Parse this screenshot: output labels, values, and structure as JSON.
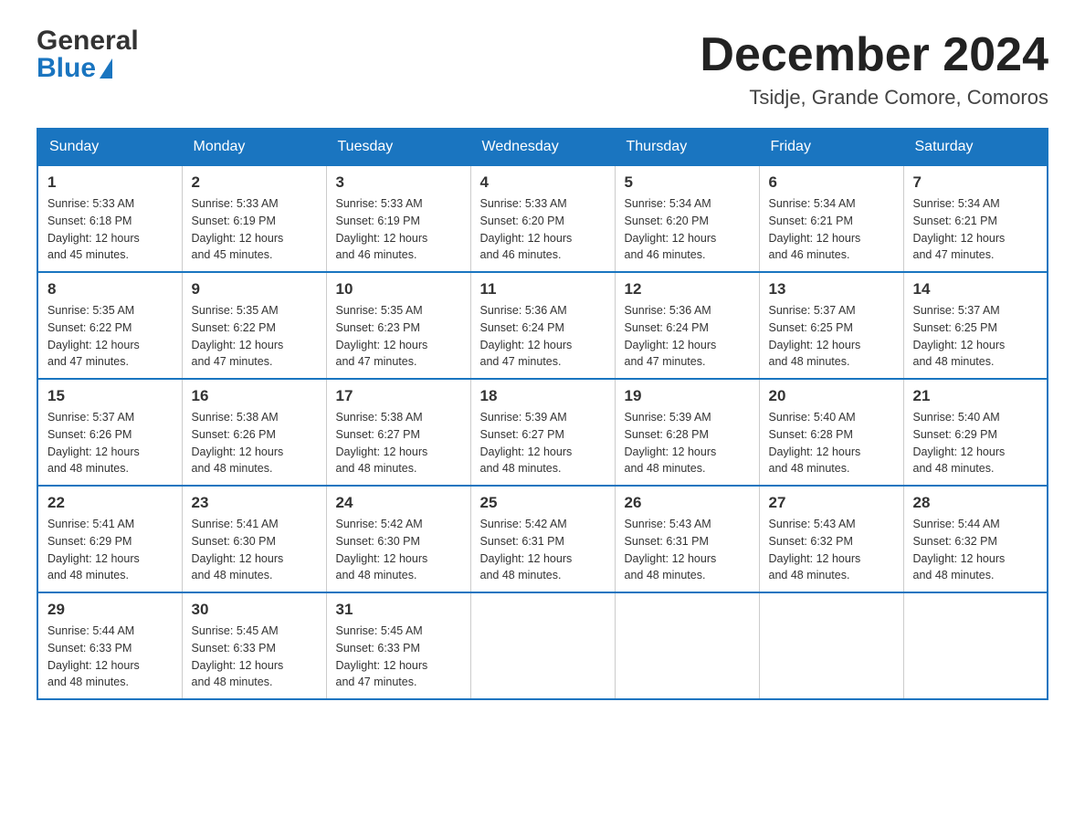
{
  "header": {
    "logo_line1": "General",
    "logo_line2": "Blue",
    "title": "December 2024",
    "subtitle": "Tsidje, Grande Comore, Comoros"
  },
  "calendar": {
    "days_of_week": [
      "Sunday",
      "Monday",
      "Tuesday",
      "Wednesday",
      "Thursday",
      "Friday",
      "Saturday"
    ],
    "weeks": [
      [
        {
          "day": "1",
          "sunrise": "5:33 AM",
          "sunset": "6:18 PM",
          "daylight": "12 hours and 45 minutes."
        },
        {
          "day": "2",
          "sunrise": "5:33 AM",
          "sunset": "6:19 PM",
          "daylight": "12 hours and 45 minutes."
        },
        {
          "day": "3",
          "sunrise": "5:33 AM",
          "sunset": "6:19 PM",
          "daylight": "12 hours and 46 minutes."
        },
        {
          "day": "4",
          "sunrise": "5:33 AM",
          "sunset": "6:20 PM",
          "daylight": "12 hours and 46 minutes."
        },
        {
          "day": "5",
          "sunrise": "5:34 AM",
          "sunset": "6:20 PM",
          "daylight": "12 hours and 46 minutes."
        },
        {
          "day": "6",
          "sunrise": "5:34 AM",
          "sunset": "6:21 PM",
          "daylight": "12 hours and 46 minutes."
        },
        {
          "day": "7",
          "sunrise": "5:34 AM",
          "sunset": "6:21 PM",
          "daylight": "12 hours and 47 minutes."
        }
      ],
      [
        {
          "day": "8",
          "sunrise": "5:35 AM",
          "sunset": "6:22 PM",
          "daylight": "12 hours and 47 minutes."
        },
        {
          "day": "9",
          "sunrise": "5:35 AM",
          "sunset": "6:22 PM",
          "daylight": "12 hours and 47 minutes."
        },
        {
          "day": "10",
          "sunrise": "5:35 AM",
          "sunset": "6:23 PM",
          "daylight": "12 hours and 47 minutes."
        },
        {
          "day": "11",
          "sunrise": "5:36 AM",
          "sunset": "6:24 PM",
          "daylight": "12 hours and 47 minutes."
        },
        {
          "day": "12",
          "sunrise": "5:36 AM",
          "sunset": "6:24 PM",
          "daylight": "12 hours and 47 minutes."
        },
        {
          "day": "13",
          "sunrise": "5:37 AM",
          "sunset": "6:25 PM",
          "daylight": "12 hours and 48 minutes."
        },
        {
          "day": "14",
          "sunrise": "5:37 AM",
          "sunset": "6:25 PM",
          "daylight": "12 hours and 48 minutes."
        }
      ],
      [
        {
          "day": "15",
          "sunrise": "5:37 AM",
          "sunset": "6:26 PM",
          "daylight": "12 hours and 48 minutes."
        },
        {
          "day": "16",
          "sunrise": "5:38 AM",
          "sunset": "6:26 PM",
          "daylight": "12 hours and 48 minutes."
        },
        {
          "day": "17",
          "sunrise": "5:38 AM",
          "sunset": "6:27 PM",
          "daylight": "12 hours and 48 minutes."
        },
        {
          "day": "18",
          "sunrise": "5:39 AM",
          "sunset": "6:27 PM",
          "daylight": "12 hours and 48 minutes."
        },
        {
          "day": "19",
          "sunrise": "5:39 AM",
          "sunset": "6:28 PM",
          "daylight": "12 hours and 48 minutes."
        },
        {
          "day": "20",
          "sunrise": "5:40 AM",
          "sunset": "6:28 PM",
          "daylight": "12 hours and 48 minutes."
        },
        {
          "day": "21",
          "sunrise": "5:40 AM",
          "sunset": "6:29 PM",
          "daylight": "12 hours and 48 minutes."
        }
      ],
      [
        {
          "day": "22",
          "sunrise": "5:41 AM",
          "sunset": "6:29 PM",
          "daylight": "12 hours and 48 minutes."
        },
        {
          "day": "23",
          "sunrise": "5:41 AM",
          "sunset": "6:30 PM",
          "daylight": "12 hours and 48 minutes."
        },
        {
          "day": "24",
          "sunrise": "5:42 AM",
          "sunset": "6:30 PM",
          "daylight": "12 hours and 48 minutes."
        },
        {
          "day": "25",
          "sunrise": "5:42 AM",
          "sunset": "6:31 PM",
          "daylight": "12 hours and 48 minutes."
        },
        {
          "day": "26",
          "sunrise": "5:43 AM",
          "sunset": "6:31 PM",
          "daylight": "12 hours and 48 minutes."
        },
        {
          "day": "27",
          "sunrise": "5:43 AM",
          "sunset": "6:32 PM",
          "daylight": "12 hours and 48 minutes."
        },
        {
          "day": "28",
          "sunrise": "5:44 AM",
          "sunset": "6:32 PM",
          "daylight": "12 hours and 48 minutes."
        }
      ],
      [
        {
          "day": "29",
          "sunrise": "5:44 AM",
          "sunset": "6:33 PM",
          "daylight": "12 hours and 48 minutes."
        },
        {
          "day": "30",
          "sunrise": "5:45 AM",
          "sunset": "6:33 PM",
          "daylight": "12 hours and 48 minutes."
        },
        {
          "day": "31",
          "sunrise": "5:45 AM",
          "sunset": "6:33 PM",
          "daylight": "12 hours and 47 minutes."
        },
        null,
        null,
        null,
        null
      ]
    ],
    "labels": {
      "sunrise": "Sunrise:",
      "sunset": "Sunset:",
      "daylight": "Daylight:"
    }
  }
}
